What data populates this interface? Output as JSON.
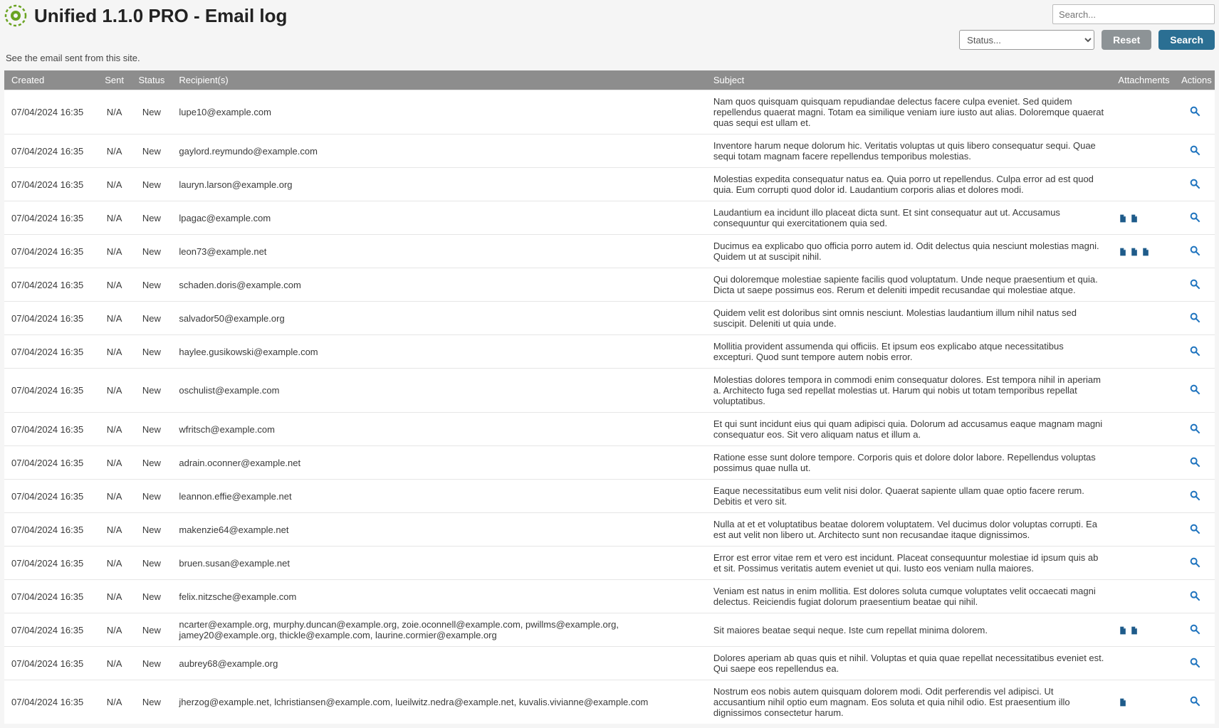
{
  "header": {
    "title": "Unified 1.1.0 PRO - Email log",
    "subtitle": "See the email sent from this site."
  },
  "controls": {
    "search_placeholder": "Search...",
    "status_placeholder": "Status...",
    "reset_label": "Reset",
    "search_label": "Search"
  },
  "table": {
    "headers": {
      "created": "Created",
      "sent": "Sent",
      "status": "Status",
      "recipients": "Recipient(s)",
      "subject": "Subject",
      "attachments": "Attachments",
      "actions": "Actions"
    },
    "rows": [
      {
        "created": "07/04/2024 16:35",
        "sent": "N/A",
        "status": "New",
        "recipients": "lupe10@example.com",
        "subject": "Nam quos quisquam quisquam repudiandae delectus facere culpa eveniet. Sed quidem repellendus quaerat magni. Totam ea similique veniam iure iusto aut alias. Doloremque quaerat quas sequi est ullam et.",
        "attachments": 0
      },
      {
        "created": "07/04/2024 16:35",
        "sent": "N/A",
        "status": "New",
        "recipients": "gaylord.reymundo@example.com",
        "subject": "Inventore harum neque dolorum hic. Veritatis voluptas ut quis libero consequatur sequi. Quae sequi totam magnam facere repellendus temporibus molestias.",
        "attachments": 0
      },
      {
        "created": "07/04/2024 16:35",
        "sent": "N/A",
        "status": "New",
        "recipients": "lauryn.larson@example.org",
        "subject": "Molestias expedita consequatur natus ea. Quia porro ut repellendus. Culpa error ad est quod quia. Eum corrupti quod dolor id. Laudantium corporis alias et dolores modi.",
        "attachments": 0
      },
      {
        "created": "07/04/2024 16:35",
        "sent": "N/A",
        "status": "New",
        "recipients": "lpagac@example.com",
        "subject": "Laudantium ea incidunt illo placeat dicta sunt. Et sint consequatur aut ut. Accusamus consequuntur qui exercitationem quia sed.",
        "attachments": 2
      },
      {
        "created": "07/04/2024 16:35",
        "sent": "N/A",
        "status": "New",
        "recipients": "leon73@example.net",
        "subject": "Ducimus ea explicabo quo officia porro autem id. Odit delectus quia nesciunt molestias magni. Quidem ut at suscipit nihil.",
        "attachments": 3
      },
      {
        "created": "07/04/2024 16:35",
        "sent": "N/A",
        "status": "New",
        "recipients": "schaden.doris@example.com",
        "subject": "Qui doloremque molestiae sapiente facilis quod voluptatum. Unde neque praesentium et quia. Dicta ut saepe possimus eos. Rerum et deleniti impedit recusandae qui molestiae atque.",
        "attachments": 0
      },
      {
        "created": "07/04/2024 16:35",
        "sent": "N/A",
        "status": "New",
        "recipients": "salvador50@example.org",
        "subject": "Quidem velit est doloribus sint omnis nesciunt. Molestias laudantium illum nihil natus sed suscipit. Deleniti ut quia unde.",
        "attachments": 0
      },
      {
        "created": "07/04/2024 16:35",
        "sent": "N/A",
        "status": "New",
        "recipients": "haylee.gusikowski@example.com",
        "subject": "Mollitia provident assumenda qui officiis. Et ipsum eos explicabo atque necessitatibus excepturi. Quod sunt tempore autem nobis error.",
        "attachments": 0
      },
      {
        "created": "07/04/2024 16:35",
        "sent": "N/A",
        "status": "New",
        "recipients": "oschulist@example.com",
        "subject": "Molestias dolores tempora in commodi enim consequatur dolores. Est tempora nihil in aperiam a. Architecto fuga sed repellat molestias ut. Harum qui nobis ut totam temporibus repellat voluptatibus.",
        "attachments": 0
      },
      {
        "created": "07/04/2024 16:35",
        "sent": "N/A",
        "status": "New",
        "recipients": "wfritsch@example.com",
        "subject": "Et qui sunt incidunt eius qui quam adipisci quia. Dolorum ad accusamus eaque magnam magni consequatur eos. Sit vero aliquam natus et illum a.",
        "attachments": 0
      },
      {
        "created": "07/04/2024 16:35",
        "sent": "N/A",
        "status": "New",
        "recipients": "adrain.oconner@example.net",
        "subject": "Ratione esse sunt dolore tempore. Corporis quis et dolore dolor labore. Repellendus voluptas possimus quae nulla ut.",
        "attachments": 0
      },
      {
        "created": "07/04/2024 16:35",
        "sent": "N/A",
        "status": "New",
        "recipients": "leannon.effie@example.net",
        "subject": "Eaque necessitatibus eum velit nisi dolor. Quaerat sapiente ullam quae optio facere rerum. Debitis et vero sit.",
        "attachments": 0
      },
      {
        "created": "07/04/2024 16:35",
        "sent": "N/A",
        "status": "New",
        "recipients": "makenzie64@example.net",
        "subject": "Nulla at et et voluptatibus beatae dolorem voluptatem. Vel ducimus dolor voluptas corrupti. Ea est aut velit non libero ut. Architecto sunt non recusandae itaque dignissimos.",
        "attachments": 0
      },
      {
        "created": "07/04/2024 16:35",
        "sent": "N/A",
        "status": "New",
        "recipients": "bruen.susan@example.net",
        "subject": "Error est error vitae rem et vero est incidunt. Placeat consequuntur molestiae id ipsum quis ab et sit. Possimus veritatis autem eveniet ut qui. Iusto eos veniam nulla maiores.",
        "attachments": 0
      },
      {
        "created": "07/04/2024 16:35",
        "sent": "N/A",
        "status": "New",
        "recipients": "felix.nitzsche@example.com",
        "subject": "Veniam est natus in enim mollitia. Est dolores soluta cumque voluptates velit occaecati magni delectus. Reiciendis fugiat dolorum praesentium beatae qui nihil.",
        "attachments": 0
      },
      {
        "created": "07/04/2024 16:35",
        "sent": "N/A",
        "status": "New",
        "recipients": "ncarter@example.org, murphy.duncan@example.org, zoie.oconnell@example.com, pwillms@example.org, jamey20@example.org, thickle@example.com, laurine.cormier@example.org",
        "subject": "Sit maiores beatae sequi neque. Iste cum repellat minima dolorem.",
        "attachments": 2
      },
      {
        "created": "07/04/2024 16:35",
        "sent": "N/A",
        "status": "New",
        "recipients": "aubrey68@example.org",
        "subject": "Dolores aperiam ab quas quis et nihil. Voluptas et quia quae repellat necessitatibus eveniet est. Qui saepe eos repellendus ea.",
        "attachments": 0
      },
      {
        "created": "07/04/2024 16:35",
        "sent": "N/A",
        "status": "New",
        "recipients": "jherzog@example.net, lchristiansen@example.com, lueilwitz.nedra@example.net, kuvalis.vivianne@example.com",
        "subject": "Nostrum eos nobis autem quisquam dolorem modi. Odit perferendis vel adipisci. Ut accusantium nihil optio eum magnam. Eos soluta et quia nihil odio. Est praesentium illo dignissimos consectetur harum.",
        "attachments": 1
      }
    ]
  }
}
